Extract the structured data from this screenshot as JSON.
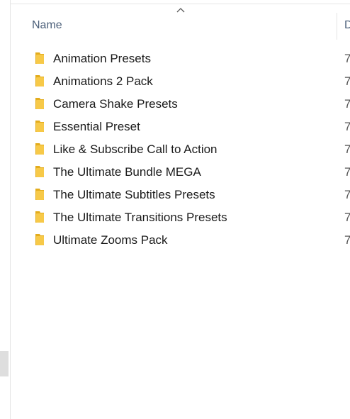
{
  "header": {
    "name_label": "Name",
    "date_label": "D"
  },
  "files": [
    {
      "name": "Animation Presets",
      "date": "7",
      "icon": "folder-icon"
    },
    {
      "name": "Animations 2 Pack",
      "date": "7",
      "icon": "folder-icon"
    },
    {
      "name": "Camera Shake Presets",
      "date": "7",
      "icon": "folder-icon"
    },
    {
      "name": "Essential Preset",
      "date": "7",
      "icon": "folder-icon"
    },
    {
      "name": "Like & Subscribe Call to Action",
      "date": "7",
      "icon": "folder-icon"
    },
    {
      "name": "The Ultimate Bundle MEGA",
      "date": "7",
      "icon": "folder-icon"
    },
    {
      "name": "The Ultimate Subtitles Presets",
      "date": "7",
      "icon": "folder-icon"
    },
    {
      "name": "The Ultimate Transitions Presets",
      "date": "7",
      "icon": "folder-icon"
    },
    {
      "name": "Ultimate Zooms Pack",
      "date": "7",
      "icon": "folder-icon"
    }
  ],
  "colors": {
    "header_text": "#4c607a",
    "folder_fill": "#f7c948",
    "folder_back": "#e3ac1d"
  }
}
